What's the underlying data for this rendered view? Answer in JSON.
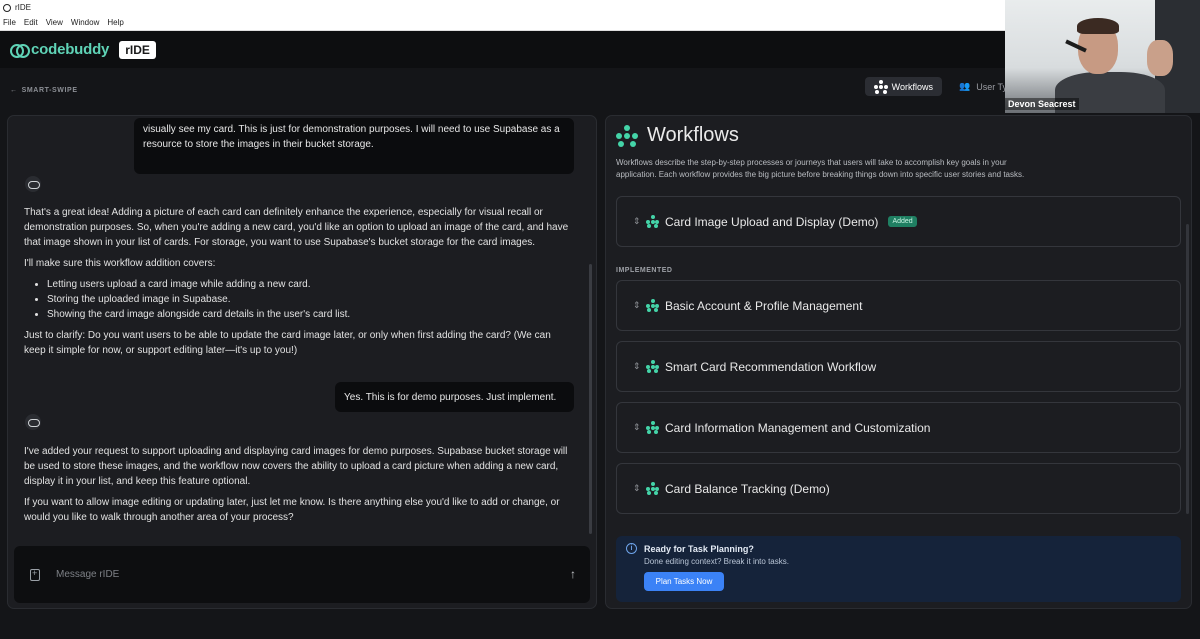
{
  "window": {
    "title": "rIDE",
    "menu": [
      "File",
      "Edit",
      "View",
      "Window",
      "Help"
    ]
  },
  "header": {
    "brand": "codebuddy",
    "product": "rIDE"
  },
  "subheader": {
    "back_label": "SMART-SWIPE",
    "tabs": [
      {
        "label": "Workflows",
        "icon": "workflow-star-icon"
      },
      {
        "label": "User Ty",
        "icon": "users-icon"
      }
    ]
  },
  "chat": {
    "messages": [
      {
        "role": "user",
        "text": "visually see my card. This is just for demonstration purposes. I will need to use Supabase as a resource to store the images in their bucket storage."
      },
      {
        "role": "assistant",
        "paragraphs": [
          "That's a great idea! Adding a picture of each card can definitely enhance the experience, especially for visual recall or demonstration purposes. So, when you're adding a new card, you'd like an option to upload an image of the card, and have that image shown in your list of cards. For storage, you want to use Supabase's bucket storage for the card images.",
          "I'll make sure this workflow addition covers:"
        ],
        "bullets": [
          "Letting users upload a card image while adding a new card.",
          "Storing the uploaded image in Supabase.",
          "Showing the card image alongside card details in the user's card list."
        ],
        "closing": "Just to clarify: Do you want users to be able to update the card image later, or only when first adding the card? (We can keep it simple for now, or support editing later—it's up to you!)"
      },
      {
        "role": "user",
        "text": "Yes. This is for demo purposes. Just implement."
      },
      {
        "role": "assistant",
        "paragraphs": [
          "I've added your request to support uploading and displaying card images for demo purposes. Supabase bucket storage will be used to store these images, and the workflow now covers the ability to upload a card picture when adding a new card, display it in your list, and keep this feature optional.",
          "If you want to allow image editing or updating later, just let me know. Is there anything else you'd like to add or change, or would you like to walk through another area of your process?"
        ]
      }
    ],
    "composer": {
      "placeholder": "Message rIDE"
    }
  },
  "workflows": {
    "title": "Workflows",
    "description": "Workflows describe the step-by-step processes or journeys that users will take to accomplish key goals in your application. Each workflow provides the big picture before breaking things down into specific user stories and tasks.",
    "new_items": [
      {
        "label": "Card Image Upload and Display (Demo)",
        "badge": "Added"
      }
    ],
    "section_label": "IMPLEMENTED",
    "implemented_items": [
      {
        "label": "Basic Account & Profile Management"
      },
      {
        "label": "Smart Card Recommendation Workflow"
      },
      {
        "label": "Card Information Management and Customization"
      },
      {
        "label": "Card Balance Tracking (Demo)"
      }
    ],
    "cta": {
      "title": "Ready for Task Planning?",
      "subtitle": "Done editing context? Break it into tasks.",
      "button": "Plan Tasks Now"
    }
  },
  "webcam": {
    "name": "Devon Seacrest"
  },
  "colors": {
    "accent": "#44d4a8",
    "brand": "#5fd3b6",
    "primary_button": "#3b82f6",
    "badge_added": "#1f7f62"
  }
}
